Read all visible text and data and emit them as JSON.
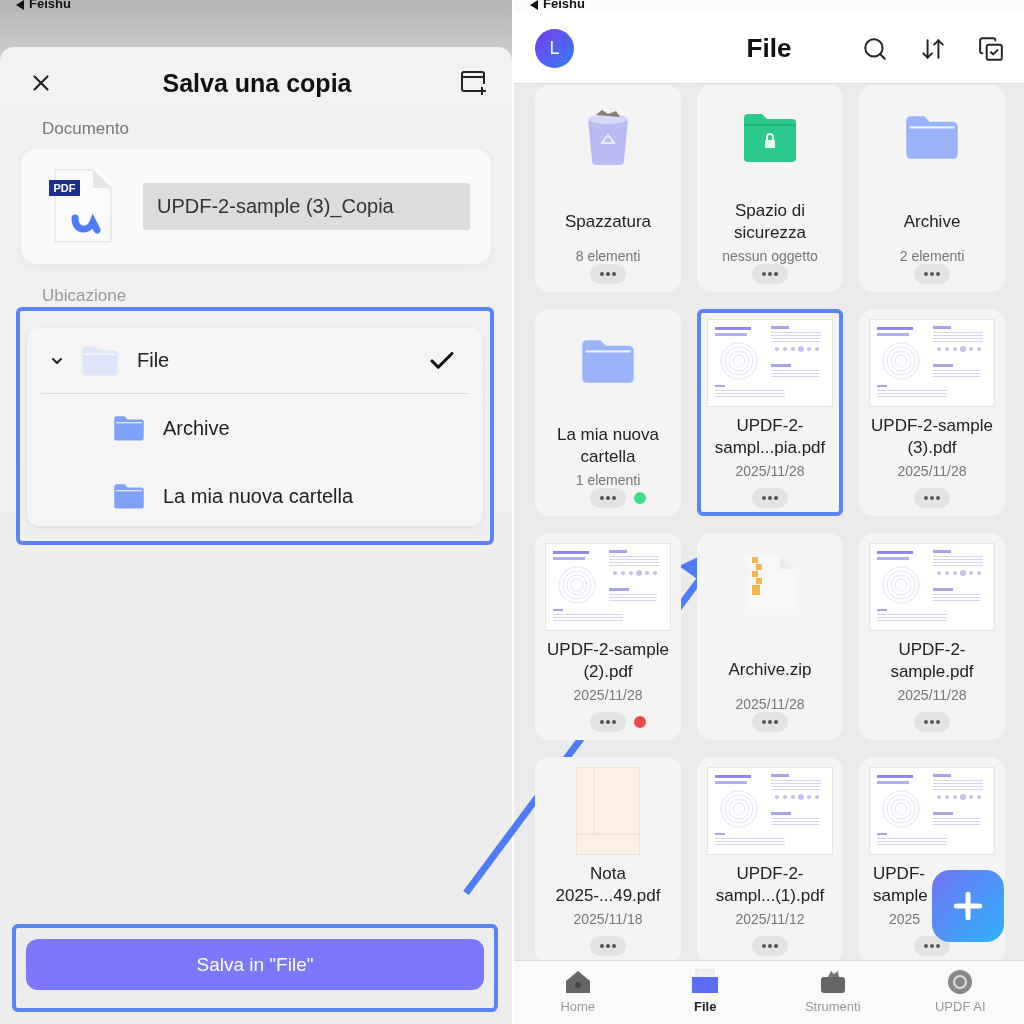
{
  "left": {
    "status_bar": {
      "back_label": "Feishu"
    },
    "sheet": {
      "title": "Salva una copia",
      "document_label": "Documento",
      "file_badge": "PDF",
      "file_name": "UPDF-2-sample (3)_Copia",
      "location_label": "Ubicazione",
      "tree": [
        {
          "name": "File",
          "expanded": true,
          "selected": true,
          "children": [
            {
              "name": "Archive",
              "selected": false
            },
            {
              "name": "La mia nuova cartella",
              "selected": false
            }
          ]
        }
      ],
      "save_button": "Salva in \"File\""
    }
  },
  "right": {
    "status_bar": {
      "back_label": "Feishu"
    },
    "avatar": "L",
    "title": "File",
    "cards": [
      {
        "kind": "trash",
        "name": "Spazzatura",
        "subtitle": "8 elementi",
        "highlighted": false
      },
      {
        "kind": "secure",
        "name": "Spazio di sicurezza",
        "subtitle": "nessun oggetto",
        "highlighted": false
      },
      {
        "kind": "folder",
        "name": "Archive",
        "subtitle": "2 elementi",
        "highlighted": false
      },
      {
        "kind": "folder",
        "name": "La mia nuova cartella",
        "subtitle": "1 elementi",
        "highlighted": false,
        "color": "#3ee08f"
      },
      {
        "kind": "pdf",
        "name": "UPDF-2-sampl...pia.pdf",
        "subtitle": "2025/11/28",
        "highlighted": true
      },
      {
        "kind": "pdf",
        "name": "UPDF-2-sample (3).pdf",
        "subtitle": "2025/11/28",
        "highlighted": false
      },
      {
        "kind": "pdf",
        "name": "UPDF-2-sample (2).pdf",
        "subtitle": "2025/11/28",
        "highlighted": false,
        "color": "#f24a4a"
      },
      {
        "kind": "zip",
        "name": "Archive.zip",
        "subtitle": "2025/11/28",
        "highlighted": false
      },
      {
        "kind": "pdf",
        "name": "UPDF-2-sample.pdf",
        "subtitle": "2025/11/28",
        "highlighted": false
      },
      {
        "kind": "note",
        "name": "Nota 2025-...49.pdf",
        "subtitle": "2025/11/18",
        "highlighted": false
      },
      {
        "kind": "pdf",
        "name": "UPDF-2-sampl...(1).pdf",
        "subtitle": "2025/11/12",
        "highlighted": false
      },
      {
        "kind": "pdf",
        "name": "UPDF-sample",
        "subtitle": "2025",
        "highlighted": false,
        "cut_by_button": true
      }
    ],
    "nav": [
      {
        "kind": "home",
        "label": "Home",
        "selected": false
      },
      {
        "kind": "file",
        "label": "File",
        "selected": true
      },
      {
        "kind": "tools",
        "label": "Strumenti",
        "selected": false
      },
      {
        "kind": "ai",
        "label": "UPDF AI",
        "selected": false
      }
    ]
  }
}
